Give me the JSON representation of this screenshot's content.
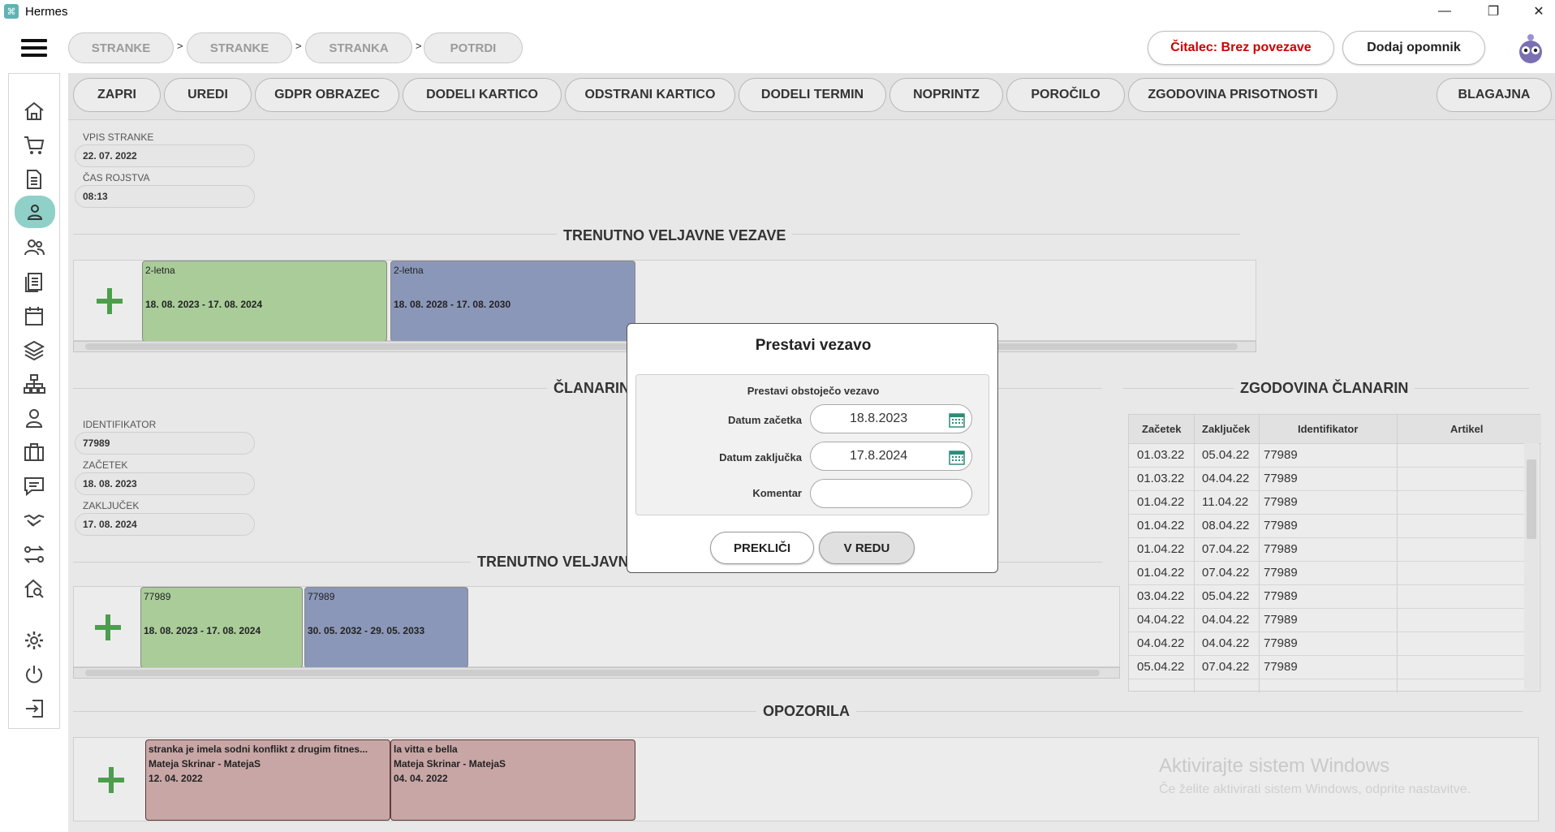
{
  "window": {
    "title": "Hermes",
    "controls": {
      "minimize": "—",
      "restore": "❐",
      "close": "✕"
    }
  },
  "breadcrumbs": [
    {
      "label": "STRANKE"
    },
    {
      "label": "STRANKE"
    },
    {
      "label": "STRANKA"
    },
    {
      "label": "POTRDI"
    }
  ],
  "breadcrumb_separator": ">",
  "header": {
    "reader_status": "Čitalec: Brez povezave",
    "reader_status_color": "#cc0000",
    "add_reminder": "Dodaj opomnik"
  },
  "sidebar": {
    "items": [
      {
        "icon": "home-icon"
      },
      {
        "icon": "cart-icon"
      },
      {
        "icon": "document-icon"
      },
      {
        "icon": "user-icon",
        "active": true
      },
      {
        "icon": "users-icon"
      },
      {
        "icon": "list-icon"
      },
      {
        "icon": "calendar-icon"
      },
      {
        "icon": "layers-icon"
      },
      {
        "icon": "hierarchy-icon"
      },
      {
        "icon": "employee-icon"
      },
      {
        "icon": "briefcase-icon"
      },
      {
        "icon": "chat-icon"
      },
      {
        "icon": "handshake-icon"
      },
      {
        "icon": "transfer-icon"
      },
      {
        "icon": "house-search-icon"
      },
      {
        "icon": "gear-icon"
      },
      {
        "icon": "power-icon"
      },
      {
        "icon": "logout-icon"
      }
    ]
  },
  "actions": {
    "zapri": "ZAPRI",
    "uredi": "UREDI",
    "gdpr": "GDPR OBRAZEC",
    "dodeli_kartico": "DODELI KARTICO",
    "odstrani_kartico": "ODSTRANI KARTICO",
    "dodeli_termin": "DODELI TERMIN",
    "noprintz": "NOPRINTZ",
    "porocilo": "POROČILO",
    "zgodovina": "ZGODOVINA PRISOTNOSTI",
    "blagajna": "BLAGAJNA"
  },
  "client": {
    "vpis_label": "VPIS STRANKE",
    "vpis_value": "22. 07. 2022",
    "cas_label": "ČAS ROJSTVA",
    "cas_value": "08:13"
  },
  "vezave": {
    "title": "TRENUTNO VELJAVNE VEZAVE",
    "cards": [
      {
        "name": "2-letna",
        "dates": "18. 08. 2023 - 17. 08. 2024"
      },
      {
        "name": "2-letna",
        "dates": "18. 08. 2028 - 17. 08. 2030"
      }
    ]
  },
  "clanarina": {
    "title": "ČLANARIN",
    "id_label": "IDENTIFIKATOR",
    "id_value": "77989",
    "start_label": "ZAČETEK",
    "start_value": "18. 08. 2023",
    "end_label": "ZAKLJUČEK",
    "end_value": "17. 08. 2024"
  },
  "veljavne2": {
    "title": "TRENUTNO VELJAVN",
    "cards": [
      {
        "name": "77989",
        "dates": "18. 08. 2023 - 17. 08. 2024"
      },
      {
        "name": "77989",
        "dates": "30. 05. 2032 - 29. 05. 2033"
      }
    ]
  },
  "history": {
    "title": "ZGODOVINA ČLANARIN",
    "columns": [
      "Začetek",
      "Zaključek",
      "Identifikator",
      "Artikel"
    ],
    "rows": [
      [
        "01.03.22",
        "05.04.22",
        "77989",
        ""
      ],
      [
        "01.03.22",
        "04.04.22",
        "77989",
        ""
      ],
      [
        "01.04.22",
        "11.04.22",
        "77989",
        ""
      ],
      [
        "01.04.22",
        "08.04.22",
        "77989",
        ""
      ],
      [
        "01.04.22",
        "07.04.22",
        "77989",
        ""
      ],
      [
        "01.04.22",
        "07.04.22",
        "77989",
        ""
      ],
      [
        "03.04.22",
        "05.04.22",
        "77989",
        ""
      ],
      [
        "04.04.22",
        "04.04.22",
        "77989",
        ""
      ],
      [
        "04.04.22",
        "04.04.22",
        "77989",
        ""
      ],
      [
        "05.04.22",
        "07.04.22",
        "77989",
        ""
      ]
    ]
  },
  "opozorila": {
    "title": "OPOZORILA",
    "cards": [
      {
        "text": "stranka je imela sodni konflikt z drugim fitnes...",
        "author": "Mateja Skrinar - MatejaS",
        "date": "12. 04. 2022"
      },
      {
        "text": "la vitta e bella",
        "author": "Mateja Skrinar - MatejaS",
        "date": "04. 04. 2022"
      }
    ]
  },
  "modal": {
    "title": "Prestavi vezavo",
    "subtitle": "Prestavi obstoječo vezavo",
    "start_label": "Datum začetka",
    "start_value": "18.8.2023",
    "end_label": "Datum zaključka",
    "end_value": "17.8.2024",
    "comment_label": "Komentar",
    "comment_value": "",
    "cancel": "PREKLIČI",
    "ok": "V REDU"
  },
  "watermark": {
    "line1": "Aktivirajte sistem Windows",
    "line2": "Če želite aktivirati sistem Windows, odprite nastavitve."
  }
}
